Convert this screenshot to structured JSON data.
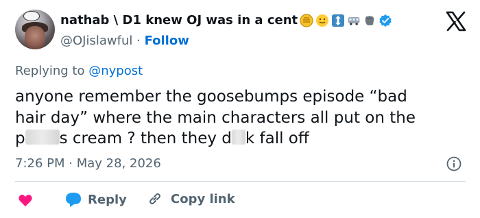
{
  "author": {
    "display_name": "nathab \\ D1 knew OJ was in a cent",
    "handle": "@OJislawful",
    "separator": "·",
    "follow_label": "Follow",
    "verified": true,
    "name_emojis": [
      "coin-emoji",
      "smiley-emoji",
      "up-down-arrow-emoji",
      "bus-emoji",
      "fist-emoji"
    ]
  },
  "replying": {
    "prefix": "Replying to",
    "mention": "@nypost"
  },
  "tweet": {
    "line1": "anyone remember the goosebumps episode “bad",
    "line2": "hair day” where the main characters all put on the",
    "line3_a": "p",
    "line3_b": "s cream ? then they d",
    "line3_c": "k fall off"
  },
  "meta": {
    "time": "7:26 PM",
    "separator": "·",
    "date": "May 28, 2026"
  },
  "actions": {
    "reply_label": "Reply",
    "copy_label": "Copy link"
  },
  "colors": {
    "link": "#006fd6",
    "secondary_text": "#536471",
    "like": "#f91880",
    "reply_icon": "#1d9bf0",
    "verified": "#1d9bf0"
  }
}
